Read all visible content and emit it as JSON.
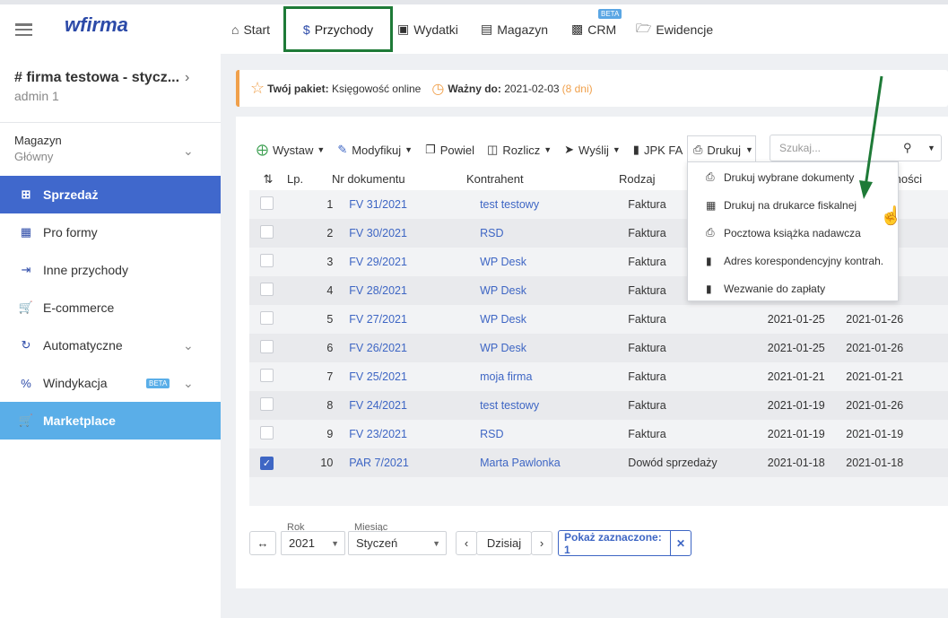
{
  "topbar": {
    "logo": "wfirma",
    "nav": [
      {
        "label": "Start",
        "icon": "home-icon"
      },
      {
        "label": "Przychody",
        "icon": "income-hand-icon"
      },
      {
        "label": "Wydatki",
        "icon": "wallet-icon"
      },
      {
        "label": "Magazyn",
        "icon": "warehouse-icon"
      },
      {
        "label": "CRM",
        "icon": "contact-card-icon",
        "badge": "BETA"
      },
      {
        "label": "Ewidencje",
        "icon": "folder-open-icon"
      }
    ]
  },
  "sidebar": {
    "firm_name": "# firma testowa - stycz...",
    "user": "admin 1",
    "warehouse_label": "Magazyn",
    "warehouse_value": "Główny",
    "items": [
      {
        "label": "Sprzedaż",
        "icon": "plus-square-icon"
      },
      {
        "label": "Pro formy",
        "icon": "document-icon"
      },
      {
        "label": "Inne przychody",
        "icon": "document-in-icon"
      },
      {
        "label": "E-commerce",
        "icon": "cart-icon"
      },
      {
        "label": "Automatyczne",
        "icon": "refresh-icon"
      },
      {
        "label": "Windykacja",
        "icon": "percent-icon",
        "badge": "BETA"
      },
      {
        "label": "Marketplace",
        "icon": "cart-icon"
      }
    ]
  },
  "notice": {
    "package_label": "Twój pakiet:",
    "package_value": "Księgowość online",
    "valid_label": "Ważny do:",
    "valid_value": "2021-02-03",
    "days_left": "(8 dni)"
  },
  "toolbar": {
    "wystaw": "Wystaw",
    "modyfikuj": "Modyfikuj",
    "powiel": "Powiel",
    "rozlicz": "Rozlicz",
    "wyslij": "Wyślij",
    "jpk": "JPK FA",
    "drukuj": "Drukuj",
    "search_placeholder": "Szukaj..."
  },
  "dropdown": [
    "Drukuj wybrane dokumenty",
    "Drukuj na drukarce fiskalnej",
    "Pocztowa książka nadawcza",
    "Adres korespondencyjny kontrah.",
    "Wezwanie do zapłaty"
  ],
  "table": {
    "headers": {
      "lp": "Lp.",
      "nr": "Nr dokumentu",
      "kontrahent": "Kontrahent",
      "rodzaj": "Rodzaj",
      "termin": "tności"
    },
    "rows": [
      {
        "lp": "1",
        "nr": "FV 31/2021",
        "kontrahent": "test testowy",
        "rodzaj": "Faktura",
        "d1": "",
        "d2": "",
        "checked": false
      },
      {
        "lp": "2",
        "nr": "FV 30/2021",
        "kontrahent": "RSD",
        "rodzaj": "Faktura",
        "d1": "",
        "d2": "",
        "checked": false
      },
      {
        "lp": "3",
        "nr": "FV 29/2021",
        "kontrahent": "WP Desk",
        "rodzaj": "Faktura",
        "d1": "",
        "d2": "",
        "checked": false
      },
      {
        "lp": "4",
        "nr": "FV 28/2021",
        "kontrahent": "WP Desk",
        "rodzaj": "Faktura",
        "d1": "",
        "d2": "",
        "checked": false
      },
      {
        "lp": "5",
        "nr": "FV 27/2021",
        "kontrahent": "WP Desk",
        "rodzaj": "Faktura",
        "d1": "2021-01-25",
        "d2": "2021-01-26",
        "checked": false
      },
      {
        "lp": "6",
        "nr": "FV 26/2021",
        "kontrahent": "WP Desk",
        "rodzaj": "Faktura",
        "d1": "2021-01-25",
        "d2": "2021-01-26",
        "checked": false
      },
      {
        "lp": "7",
        "nr": "FV 25/2021",
        "kontrahent": "moja firma",
        "rodzaj": "Faktura",
        "d1": "2021-01-21",
        "d2": "2021-01-21",
        "checked": false
      },
      {
        "lp": "8",
        "nr": "FV 24/2021",
        "kontrahent": "test testowy",
        "rodzaj": "Faktura",
        "d1": "2021-01-19",
        "d2": "2021-01-26",
        "checked": false
      },
      {
        "lp": "9",
        "nr": "FV 23/2021",
        "kontrahent": "RSD",
        "rodzaj": "Faktura",
        "d1": "2021-01-19",
        "d2": "2021-01-19",
        "checked": false
      },
      {
        "lp": "10",
        "nr": "PAR 7/2021",
        "kontrahent": "Marta Pawlonka",
        "rodzaj": "Dowód sprzedaży",
        "d1": "2021-01-18",
        "d2": "2021-01-18",
        "checked": true
      }
    ]
  },
  "pager": {
    "rok_label": "Rok",
    "rok_value": "2021",
    "miesiac_label": "Miesiąc",
    "miesiac_value": "Styczeń",
    "dzisiaj": "Dzisiaj",
    "pokaz": "Pokaż zaznaczone: 1"
  },
  "colors": {
    "accent": "#4068cc",
    "marketplace": "#5aaee8",
    "highlight": "#1e7a37",
    "warning": "#f0a04b",
    "link": "#3e66c4"
  }
}
